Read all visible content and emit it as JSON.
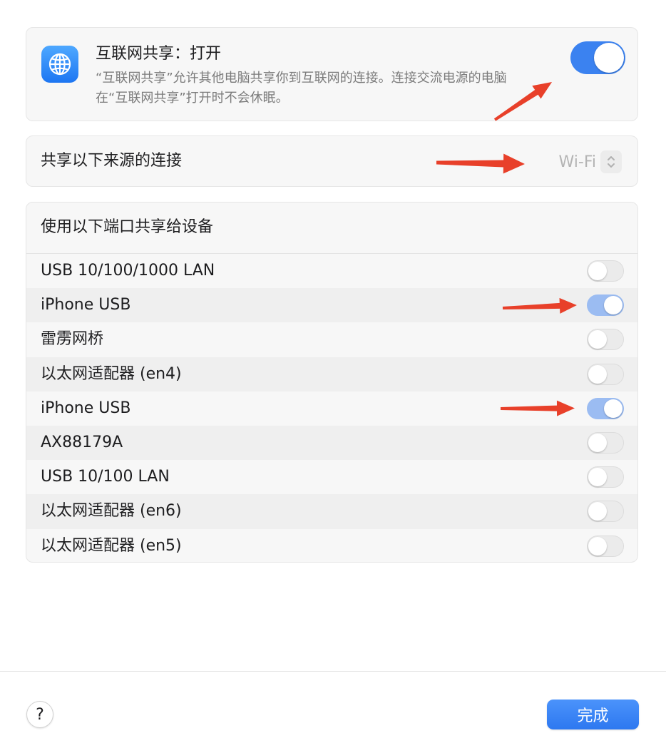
{
  "sharing": {
    "title": "互联网共享：打开",
    "description": "“互联网共享”允许其他电脑共享你到互联网的连接。连接交流电源的电脑在“互联网共享”打开时不会休眠。",
    "enabled": true,
    "icon": "globe-icon"
  },
  "source": {
    "label": "共享以下来源的连接",
    "value": "Wi-Fi"
  },
  "ports": {
    "header": "使用以下端口共享给设备",
    "items": [
      {
        "label": "USB 10/100/1000 LAN",
        "enabled": false
      },
      {
        "label": "iPhone USB",
        "enabled": true
      },
      {
        "label": "雷雳网桥",
        "enabled": false
      },
      {
        "label": "以太网适配器 (en4)",
        "enabled": false
      },
      {
        "label": "iPhone USB",
        "enabled": true
      },
      {
        "label": "AX88179A",
        "enabled": false
      },
      {
        "label": "USB 10/100 LAN",
        "enabled": false
      },
      {
        "label": "以太网适配器 (en6)",
        "enabled": false
      },
      {
        "label": "以太网适配器 (en5)",
        "enabled": false
      }
    ]
  },
  "footer": {
    "help_label": "?",
    "done_label": "完成"
  },
  "colors": {
    "accent": "#3b82f0",
    "accent_dim": "#9bbcf2",
    "annotation_arrow": "#e8402a"
  }
}
